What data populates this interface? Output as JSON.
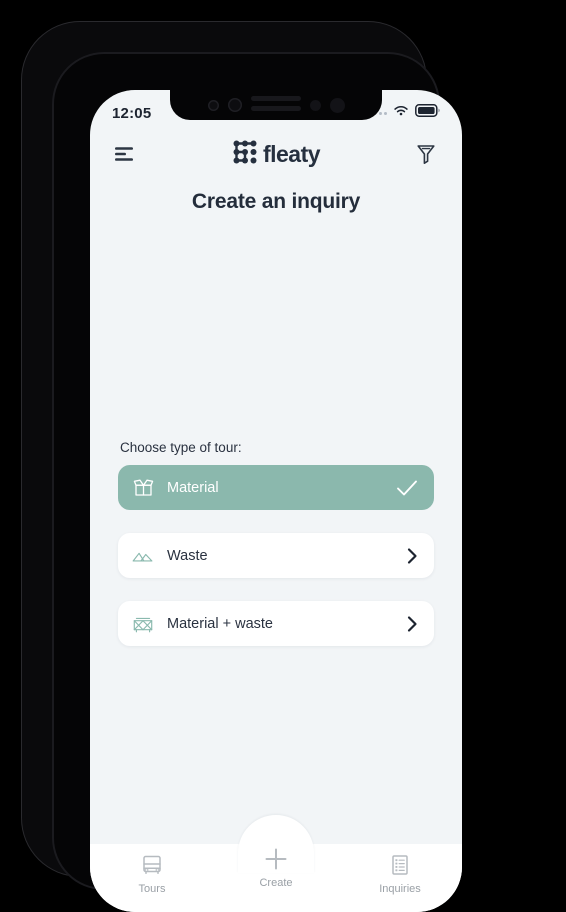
{
  "status_bar": {
    "time": "12:05",
    "signal_icon": "signal-dots-icon",
    "wifi_icon": "wifi-icon",
    "battery_icon": "battery-full-icon"
  },
  "header": {
    "menu_icon": "hamburger-menu-icon",
    "brand_name": "fleaty",
    "brand_mark_icon": "fleaty-dot-grid-logo-icon",
    "filter_icon": "funnel-filter-icon"
  },
  "page": {
    "title": "Create an inquiry"
  },
  "form": {
    "choose_label": "Choose type of tour:",
    "options": [
      {
        "label": "Material",
        "icon": "open-box-icon",
        "selected": true,
        "trailing_icon": "check-icon"
      },
      {
        "label": "Waste",
        "icon": "waste-pile-icon",
        "selected": false,
        "trailing_icon": "chevron-right-icon"
      },
      {
        "label": "Material + waste",
        "icon": "box-and-waste-pile-icon",
        "selected": false,
        "trailing_icon": "chevron-right-icon"
      }
    ]
  },
  "bottom_nav": {
    "items": [
      {
        "label": "Tours",
        "icon": "truck-icon"
      },
      {
        "label": "Create",
        "icon": "plus-icon"
      },
      {
        "label": "Inquiries",
        "icon": "document-list-icon"
      }
    ]
  },
  "colors": {
    "accent_green": "#8bb8ad",
    "icon_green": "#8ab9ae",
    "text_dark": "#2a3240",
    "screen_bg": "#f2f5f7",
    "nav_label": "#9aa0a6"
  }
}
